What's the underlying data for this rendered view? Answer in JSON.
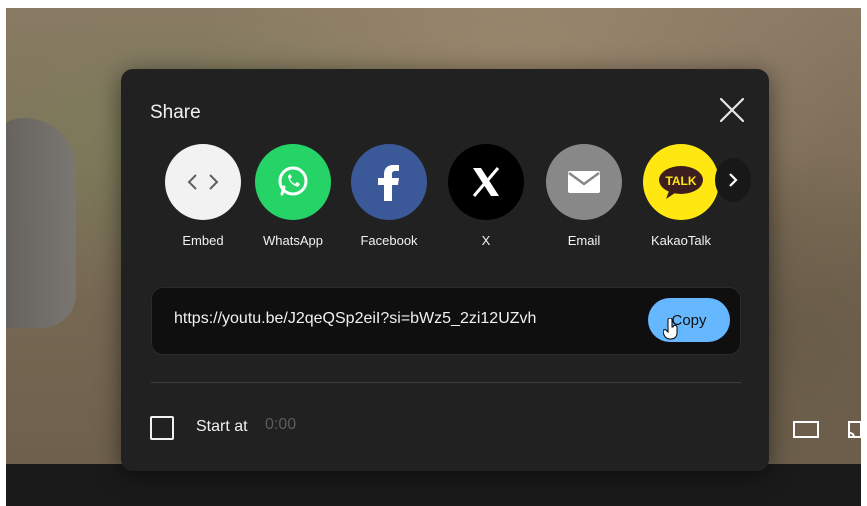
{
  "modal": {
    "title": "Share",
    "close_icon": "close-icon"
  },
  "share_targets": [
    {
      "id": "embed",
      "label": "Embed",
      "icon": "embed-icon",
      "color": "#f2f2f2"
    },
    {
      "id": "whatsapp",
      "label": "WhatsApp",
      "icon": "whatsapp-icon",
      "color": "#25d366"
    },
    {
      "id": "facebook",
      "label": "Facebook",
      "icon": "facebook-icon",
      "color": "#3b5998"
    },
    {
      "id": "x",
      "label": "X",
      "icon": "x-icon",
      "color": "#000000"
    },
    {
      "id": "email",
      "label": "Email",
      "icon": "email-icon",
      "color": "#888888"
    },
    {
      "id": "kakaotalk",
      "label": "KakaoTalk",
      "icon": "kakaotalk-icon",
      "color": "#ffe812",
      "badge_text": "TALK"
    }
  ],
  "next_icon": "chevron-right-icon",
  "link": {
    "url": "https://youtu.be/J2qeQSp2eiI?si=bWz5_2zi12UZvh",
    "copy_label": "Copy"
  },
  "start_at": {
    "label": "Start at",
    "value": "0:00",
    "checked": false
  },
  "colors": {
    "modal_bg": "#212121",
    "accent": "#65b8ff",
    "url_bg": "#0f0f0f"
  }
}
